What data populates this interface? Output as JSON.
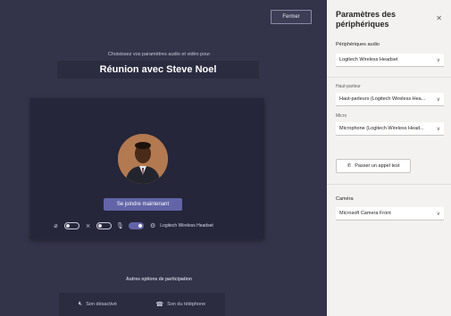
{
  "main": {
    "close_label": "Fermer",
    "subtitle": "Choisissez vos paramètres audio et vidéo pour",
    "title": "Réunion avec Steve Noel",
    "join_label": "Se joindre maintenant",
    "controls": {
      "device_label": "Logitech Wireless Headset"
    },
    "other_options_label": "Autres options de participation",
    "options": [
      {
        "label": "Son désactivé",
        "icon": "speaker-off-icon"
      },
      {
        "label": "Son du téléphone",
        "icon": "phone-icon"
      }
    ]
  },
  "panel": {
    "title": "Paramètres des périphériques",
    "audio_label": "Périphériques audio",
    "audio_value": "Logitech Wireless Headset",
    "speaker_label": "Haut-parleur",
    "speaker_value": "Haut-parleurs (Logitech Wireless Hea...",
    "mic_label": "Micro",
    "mic_value": "Microphone (Logitech Wireless Head...",
    "test_call_label": "Passer un appel test",
    "camera_label": "Caméra",
    "camera_value": "Microsoft Camera Front"
  },
  "colors": {
    "accent": "#6264a7",
    "background": "#33344a",
    "panel": "#f3f2f1"
  }
}
